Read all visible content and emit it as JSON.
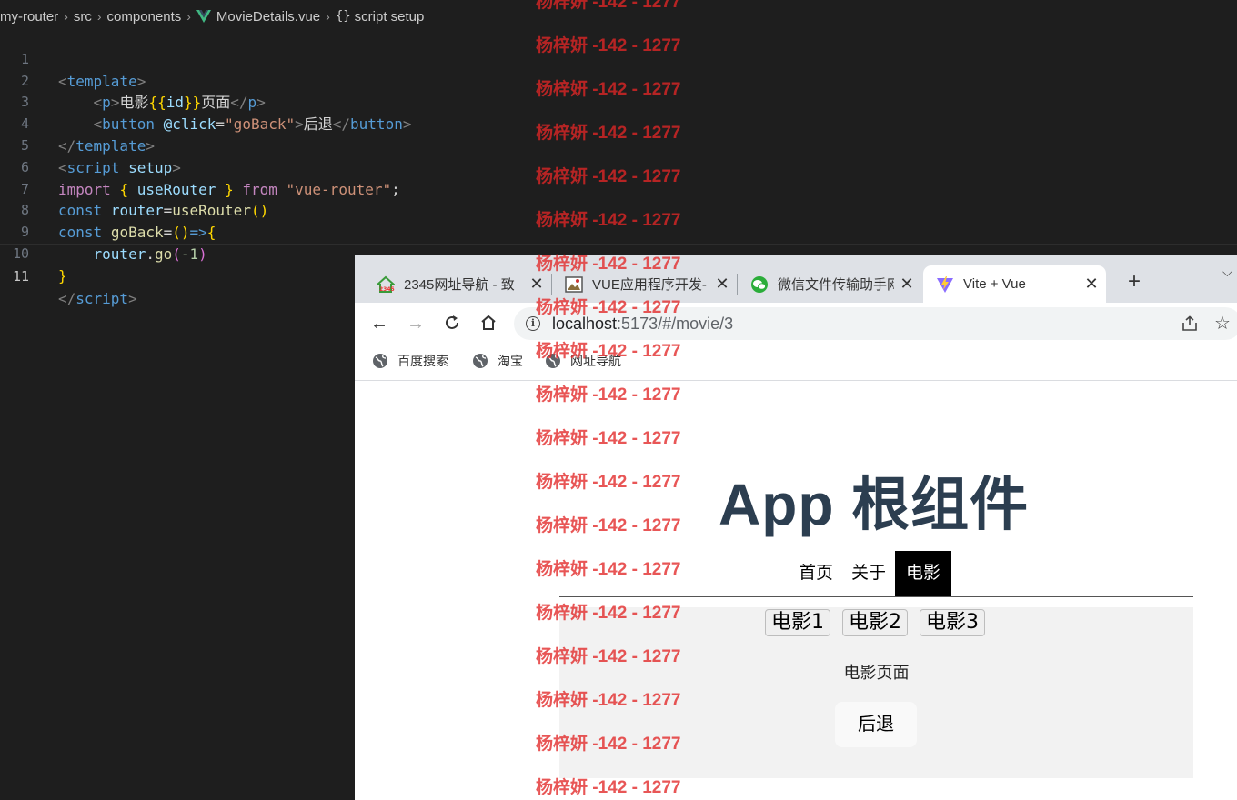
{
  "editor": {
    "breadcrumb": [
      "my-router",
      "src",
      "components",
      "MovieDetails.vue",
      "script setup"
    ],
    "line_numbers": [
      "1",
      "2",
      "3",
      "4",
      "5",
      "6",
      "7",
      "8",
      "9",
      "10",
      "11"
    ],
    "active_line": "11",
    "code": {
      "l1": [
        "<",
        "template",
        ">"
      ],
      "l2": [
        "<",
        "p",
        ">",
        "电影",
        "{{",
        "id",
        "}}",
        "页面",
        "</",
        "p",
        ">"
      ],
      "l3": [
        "<",
        "button",
        "@click",
        "=",
        "\"goBack\"",
        ">",
        "后退",
        "</",
        "button",
        ">"
      ],
      "l4": [
        "</",
        "template",
        ">"
      ],
      "l5": [
        "<",
        "script",
        "setup",
        ">"
      ],
      "l6": [
        "import",
        "{",
        "useRouter",
        "}",
        "from",
        "\"vue-router\"",
        ";"
      ],
      "l7": [
        "const",
        "router",
        "=",
        "useRouter",
        "()"
      ],
      "l8": [
        "const",
        "goBack",
        "=",
        "()",
        "=>",
        "{"
      ],
      "l9": [
        "router",
        ".",
        "go",
        "(",
        "-1",
        ")"
      ],
      "l10": [
        "}"
      ],
      "l11": [
        "</",
        "script",
        ">"
      ]
    }
  },
  "browser": {
    "tabs": [
      {
        "label": "2345网址导航 - 致"
      },
      {
        "label": "VUE应用程序开发-"
      },
      {
        "label": "微信文件传输助手网"
      },
      {
        "label": "Vite + Vue"
      }
    ],
    "new_tab": "+",
    "tab_menu": "⌵",
    "close_glyph": "✕",
    "url_host": "localhost",
    "url_rest": ":5173/#/movie/3",
    "bookmarks": [
      "百度搜索",
      "淘宝",
      "网址导航"
    ]
  },
  "page": {
    "title": "App 根组件",
    "nav": [
      "首页",
      "关于",
      "电影"
    ],
    "movie_buttons": [
      "电影1",
      "电影2",
      "电影3"
    ],
    "movie_text": "电影页面",
    "back_button": "后退"
  },
  "watermark": {
    "text": "杨梓妍 -142 - 1277"
  },
  "colors": {
    "editor_bg": "#1e1e1e",
    "title": "#2c3e50",
    "active_nav_bg": "#000000",
    "watermark": "#e22626"
  }
}
